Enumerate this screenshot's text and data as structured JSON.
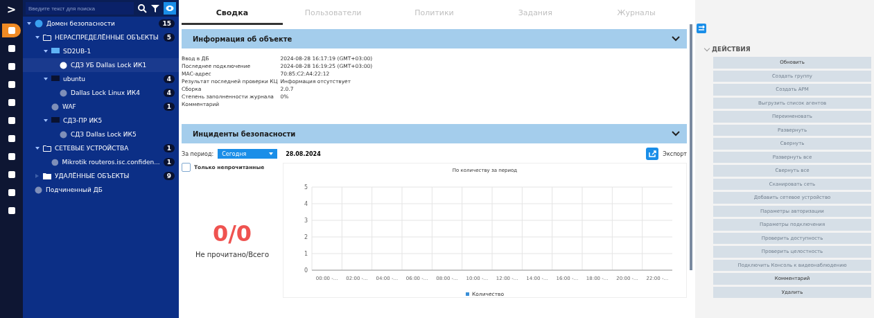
{
  "rail": {
    "toggle": ">",
    "items": [
      {
        "selected": true
      },
      {
        "selected": false
      },
      {
        "selected": false
      },
      {
        "selected": false
      },
      {
        "selected": false
      },
      {
        "selected": false
      },
      {
        "selected": false
      },
      {
        "selected": false
      },
      {
        "selected": false
      },
      {
        "selected": false
      },
      {
        "selected": false
      }
    ]
  },
  "search": {
    "placeholder": "Введите текст для поиска"
  },
  "tree": [
    {
      "label": "Домен безопасности",
      "kind": "globe",
      "expanded": true,
      "count": "15",
      "selected": false,
      "children": [
        {
          "label": "НЕРАСПРЕДЕЛЁННЫЕ ОБЪЕКТЫ",
          "kind": "folder",
          "expanded": true,
          "count": "5",
          "selected": false,
          "children": [
            {
              "label": "SD2UB-1",
              "kind": "monitor",
              "expanded": true,
              "selected": false,
              "children": [
                {
                  "label": "СДЗ УБ Dallas Lock ИК1",
                  "kind": "agent",
                  "selected": true
                }
              ]
            },
            {
              "label": "ubuntu",
              "kind": "monitor-dark",
              "expanded": true,
              "count": "4",
              "selected": false,
              "children": [
                {
                  "label": "Dallas Lock Linux ИК4",
                  "kind": "agent",
                  "count": "4",
                  "selected": false
                }
              ]
            },
            {
              "label": "WAF",
              "kind": "agent",
              "count": "1",
              "selected": false
            },
            {
              "label": "СДЗ-ПР ИК5",
              "kind": "monitor-dark",
              "expanded": true,
              "selected": false,
              "children": [
                {
                  "label": "СДЗ Dallas Lock ИК5",
                  "kind": "agent",
                  "selected": false
                }
              ]
            }
          ]
        },
        {
          "label": "СЕТЕВЫЕ УСТРОЙСТВА",
          "kind": "folder",
          "expanded": true,
          "count": "1",
          "selected": false,
          "children": [
            {
              "label": "Mikrotik routeros.isc.confiden...",
              "kind": "agent",
              "count": "1",
              "selected": false
            }
          ]
        },
        {
          "label": "УДАЛЁННЫЕ ОБЪЕКТЫ",
          "kind": "folder-filled",
          "expanded": false,
          "count": "9",
          "selected": false
        }
      ]
    },
    {
      "label": "Подчиненный ДБ",
      "kind": "agent",
      "selected": false
    }
  ],
  "tabs": [
    {
      "label": "Сводка",
      "selected": true
    },
    {
      "label": "Пользователи",
      "selected": false
    },
    {
      "label": "Политики",
      "selected": false
    },
    {
      "label": "Задания",
      "selected": false
    },
    {
      "label": "Журналы",
      "selected": false
    }
  ],
  "object_info": {
    "title": "Информация об объекте",
    "expanded": true,
    "fields": [
      {
        "label": "Ввод в ДБ",
        "value": "2024-08-28 16:17:19 (GMT+03:00)"
      },
      {
        "label": "Последнее подключение",
        "value": "2024-08-28 16:19:25 (GMT+03:00)"
      },
      {
        "label": "MAC-адрес",
        "value": "70:85:C2:A4:22:12"
      },
      {
        "label": "Результат последней проверки КЦ",
        "value": "Информация отсутствует"
      },
      {
        "label": "Сборка",
        "value": "2.0.7"
      },
      {
        "label": "Степень заполненности журнала",
        "value": "0%"
      },
      {
        "label": "Комментарий"
      }
    ]
  },
  "incidents": {
    "title": "Инциденты безопасности",
    "expanded": true,
    "period_label": "За период:",
    "period": "Сегодня",
    "date": "28.08.2024",
    "export": "Экспорт",
    "unread_only": {
      "label": "Только непрочитанные",
      "checked": false
    },
    "counter": "0/0",
    "counter_caption": "Не прочитано/Всего",
    "chart_data": {
      "type": "bar",
      "title": "По количеству за период",
      "categories": [
        "00:00 -...",
        "02:00 -...",
        "04:00 -...",
        "06:00 -...",
        "08:00 -...",
        "10:00 -...",
        "12:00 -...",
        "14:00 -...",
        "16:00 -...",
        "18:00 -...",
        "20:00 -...",
        "22:00 -..."
      ],
      "ylim": [
        0,
        5
      ],
      "grid": true,
      "yticks": [
        0,
        1,
        2,
        3,
        4,
        5
      ],
      "series": [
        {
          "name": "Количество",
          "color": "#3a8fd8",
          "values": [
            0,
            0,
            0,
            0,
            0,
            0,
            0,
            0,
            0,
            0,
            0,
            0
          ]
        }
      ]
    }
  },
  "actions": {
    "title": "ДЕЙСТВИЯ",
    "expanded": true,
    "buttons": [
      {
        "label": "Обновить",
        "disabled": false
      },
      {
        "label": "Создать группу",
        "disabled": true
      },
      {
        "label": "Создать АРМ",
        "disabled": true
      },
      {
        "label": "Выгрузить список агентов",
        "disabled": true
      },
      {
        "label": "Переименовать",
        "disabled": true
      },
      {
        "label": "Развернуть",
        "disabled": true
      },
      {
        "label": "Свернуть",
        "disabled": true
      },
      {
        "label": "Развернуть все",
        "disabled": true
      },
      {
        "label": "Свернуть все",
        "disabled": true
      },
      {
        "label": "Сканировать сеть",
        "disabled": true
      },
      {
        "label": "Добавить сетевое устройство",
        "disabled": true
      },
      {
        "label": "Параметры авторизации",
        "disabled": true
      },
      {
        "label": "Параметры подключения",
        "disabled": true
      },
      {
        "label": "Проверить доступность",
        "disabled": true
      },
      {
        "label": "Проверить целостность",
        "disabled": true
      },
      {
        "label": "Подключить Консоль к видеонаблюдению",
        "disabled": true
      },
      {
        "label": "Комментарий",
        "disabled": false
      },
      {
        "label": "Удалить",
        "disabled": false
      }
    ]
  }
}
